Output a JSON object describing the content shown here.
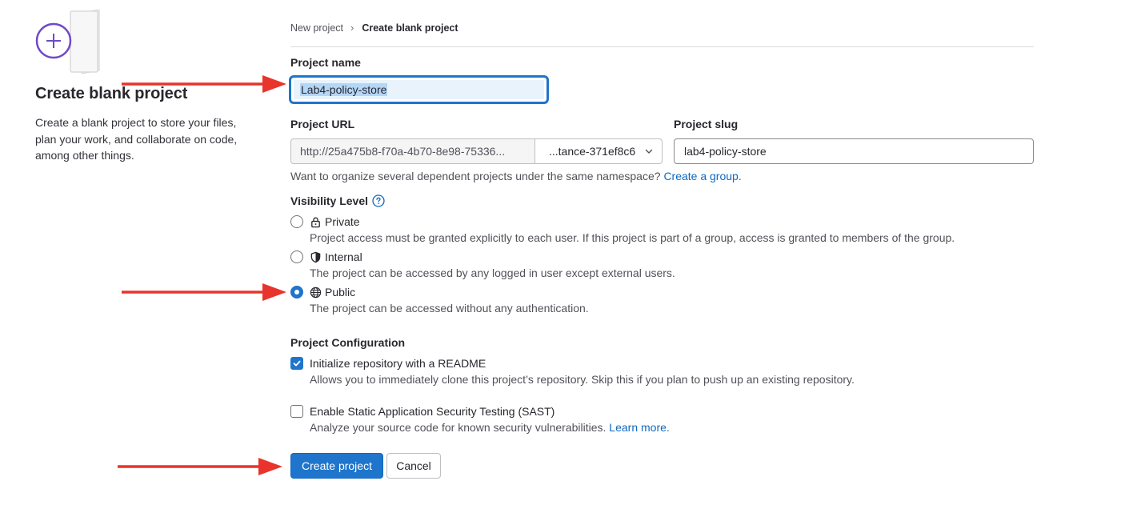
{
  "left": {
    "title": "Create blank project",
    "description": "Create a blank project to store your files, plan your work, and collaborate on code, among other things."
  },
  "breadcrumb": {
    "parent": "New project",
    "current": "Create blank project"
  },
  "form": {
    "project_name_label": "Project name",
    "project_name_value": "Lab4-policy-store",
    "project_url_label": "Project URL",
    "project_url_prefix": "http://25a475b8-f70a-4b70-8e98-75336...",
    "project_url_namespace": "...tance-371ef8c6",
    "project_slug_label": "Project slug",
    "project_slug_value": "lab4-policy-store",
    "namespace_help_text": "Want to organize several dependent projects under the same namespace?",
    "namespace_help_link": "Create a group.",
    "visibility_label": "Visibility Level",
    "visibility_options": [
      {
        "label": "Private",
        "description": "Project access must be granted explicitly to each user. If this project is part of a group, access is granted to members of the group.",
        "icon": "lock-icon",
        "selected": false
      },
      {
        "label": "Internal",
        "description": "The project can be accessed by any logged in user except external users.",
        "icon": "shield-icon",
        "selected": false
      },
      {
        "label": "Public",
        "description": "The project can be accessed without any authentication.",
        "icon": "globe-icon",
        "selected": true
      }
    ],
    "config_label": "Project Configuration",
    "readme_label": "Initialize repository with a README",
    "readme_desc": "Allows you to immediately clone this project’s repository. Skip this if you plan to push up an existing repository.",
    "readme_checked": true,
    "sast_label": "Enable Static Application Security Testing (SAST)",
    "sast_desc": "Analyze your source code for known security vulnerabilities.",
    "sast_link": "Learn more.",
    "sast_checked": false,
    "create_button": "Create project",
    "cancel_button": "Cancel"
  },
  "colors": {
    "primary": "#1f75cb",
    "link": "#1068bf",
    "annotation_arrow": "#e8342c",
    "illustration_accent": "#6e49cb"
  }
}
